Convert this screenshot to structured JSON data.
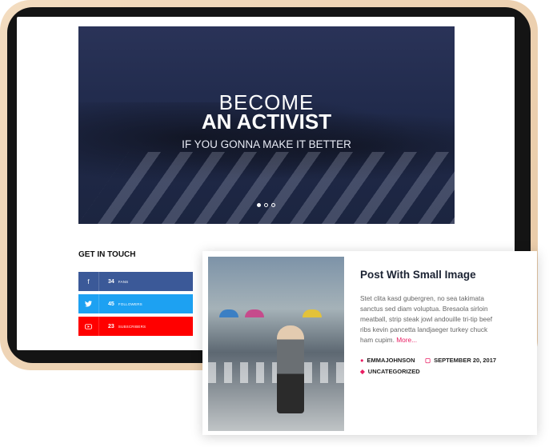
{
  "hero": {
    "line1": "BECOME",
    "line2": "AN ACTIVIST",
    "subtitle": "IF YOU GONNA MAKE IT BETTER",
    "active_slide": 1,
    "slide_count": 3
  },
  "get_in_touch": {
    "title": "GET IN TOUCH",
    "items": [
      {
        "icon": "facebook-icon",
        "glyph": "f",
        "count": "34",
        "label": "FANS",
        "color": "#3b5998"
      },
      {
        "icon": "twitter-icon",
        "glyph": "🐦",
        "count": "45",
        "label": "FOLLOWERS",
        "color": "#1da1f2"
      },
      {
        "icon": "youtube-icon",
        "glyph": "▶",
        "count": "23",
        "label": "SUBSCRIBERS",
        "color": "#ff0000"
      }
    ]
  },
  "post": {
    "title": "Post With Small Image",
    "excerpt": "Stet clita kasd gubergren, no sea takimata sanctus sed diam voluptua. Bresaola sirloin meatball, strip steak jowl andouille tri-tip beef ribs kevin pancetta landjaeger turkey chuck ham cupim.",
    "more_label": "More...",
    "author": "EMMAJOHNSON",
    "date": "SEPTEMBER 20, 2017",
    "category": "UNCATEGORIZED",
    "accent_color": "#e91e63"
  }
}
